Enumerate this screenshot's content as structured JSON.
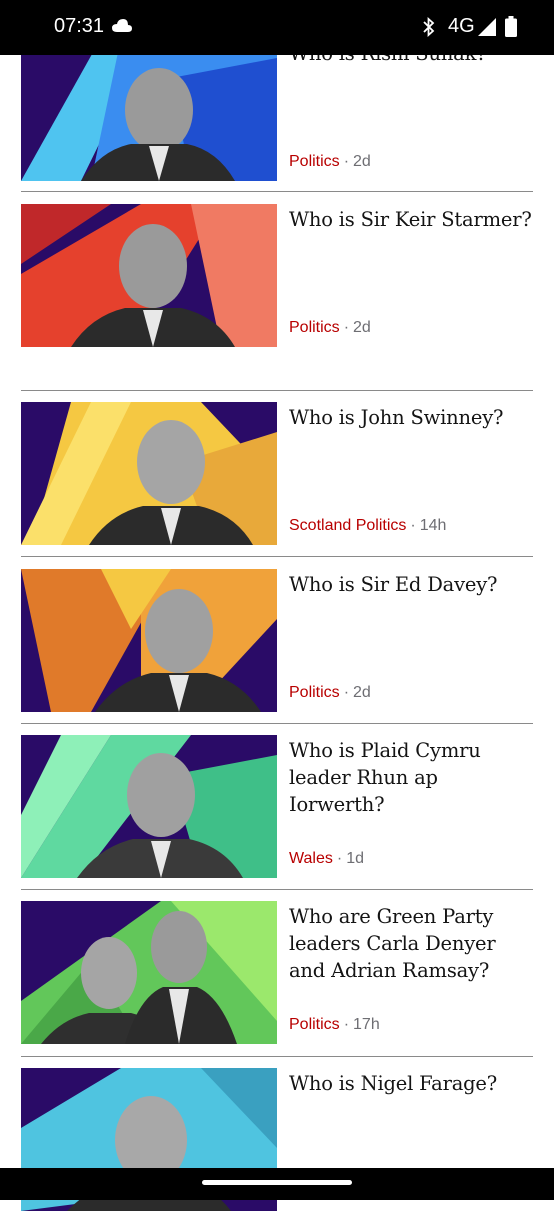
{
  "status_bar": {
    "time": "07:31",
    "network": "4G"
  },
  "articles": [
    {
      "headline": "Who is Rishi Sunak?",
      "topic": "Politics",
      "age": "2d"
    },
    {
      "headline": "Who is Sir Keir Starmer?",
      "topic": "Politics",
      "age": "2d"
    },
    {
      "headline": "Who is John Swinney?",
      "topic": "Scotland Politics",
      "age": "14h"
    },
    {
      "headline": "Who is Sir Ed Davey?",
      "topic": "Politics",
      "age": "2d"
    },
    {
      "headline": "Who is Plaid Cymru leader Rhun ap Iorwerth?",
      "topic": "Wales",
      "age": "1d"
    },
    {
      "headline": "Who are Green Party leaders Carla Denyer and Adrian Ramsay?",
      "topic": "Politics",
      "age": "17h"
    },
    {
      "headline": "Who is Nigel Farage?",
      "topic": "",
      "age": ""
    }
  ],
  "meta_separator": "·",
  "colors": {
    "background_purple": "#2a0b67",
    "topic_red": "#b80000",
    "sunak_blue": "#3a8df0",
    "starmer_red": "#e5412d",
    "swinney_yellow": "#f5c842",
    "davey_orange": "#f0a23a",
    "plaid_green": "#5fd9a0",
    "green_party_green": "#62c75a",
    "farage_cyan": "#4fc4e0"
  }
}
